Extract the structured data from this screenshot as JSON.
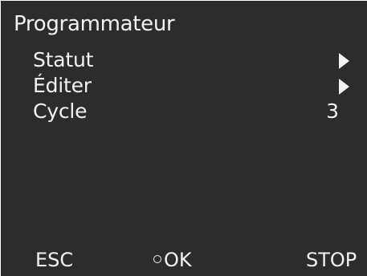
{
  "screen": {
    "title": "Programmateur"
  },
  "menu": {
    "items": [
      {
        "label": "Statut",
        "indicator": "right-arrow-icon"
      },
      {
        "label": "Éditer",
        "indicator": "right-arrow-icon"
      },
      {
        "label": "Cycle",
        "value": "3"
      }
    ]
  },
  "softkeys": {
    "esc": "ESC",
    "ok": "OK",
    "ok_icon": "ring-icon",
    "stop": "STOP"
  },
  "colors": {
    "background": "#2c2c2c",
    "foreground": "#f2f2f2"
  }
}
